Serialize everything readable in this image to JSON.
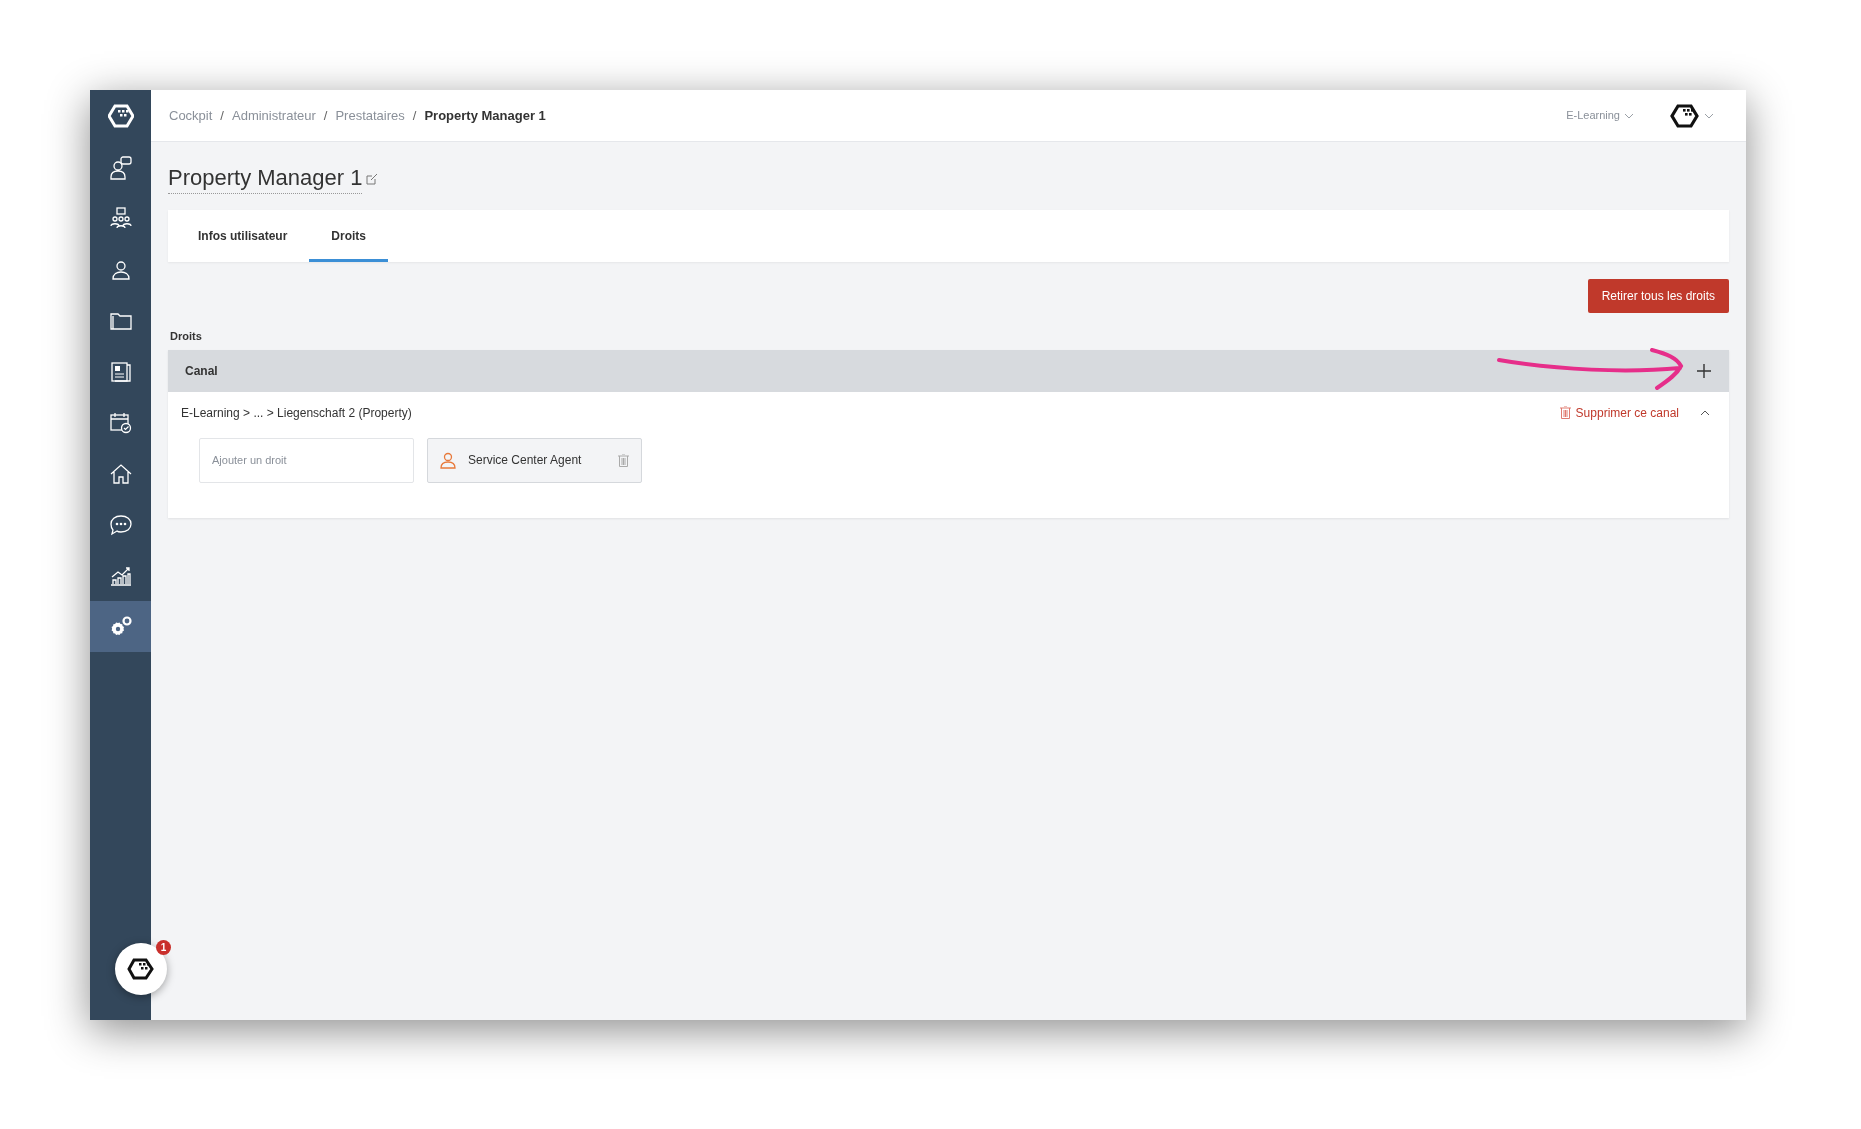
{
  "sidebar": {
    "items": [
      {
        "selected": false
      },
      {
        "selected": false
      },
      {
        "selected": false
      },
      {
        "selected": false
      },
      {
        "selected": false
      },
      {
        "selected": false
      },
      {
        "selected": false
      },
      {
        "selected": false
      },
      {
        "selected": false
      },
      {
        "selected": true
      }
    ],
    "notification_badge": "1"
  },
  "breadcrumb": [
    {
      "label": "Cockpit",
      "current": false
    },
    {
      "label": "Administrateur",
      "current": false
    },
    {
      "label": "Prestataires",
      "current": false
    },
    {
      "label": "Property Manager 1",
      "current": true
    }
  ],
  "breadcrumb_separator": "/",
  "top_bar": {
    "channel_menu": "E-Learning"
  },
  "page_title": "Property Manager 1",
  "tabs": [
    {
      "label": "Infos utilisateur",
      "selected": false
    },
    {
      "label": "Droits",
      "selected": true
    }
  ],
  "remove_all_button": "Retirer tous les droits",
  "section_label": "Droits",
  "table": {
    "header": "Canal",
    "rows": [
      {
        "path": "E-Learning > ... > Liegenschaft 2 (Property)",
        "delete_label": "Supprimer ce canal",
        "expanded": true,
        "add_field": {
          "placeholder": "Ajouter un droit"
        },
        "rights": [
          "Service Center Agent"
        ]
      }
    ]
  }
}
